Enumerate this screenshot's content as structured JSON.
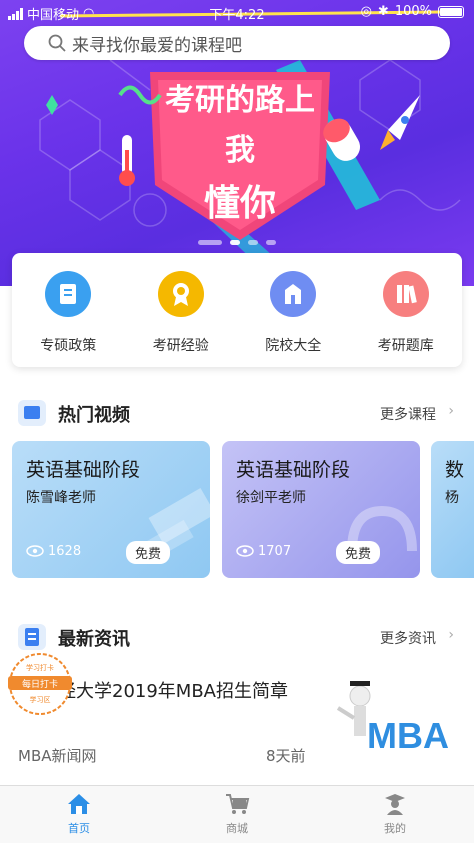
{
  "status_bar": {
    "carrier": "中国移动",
    "time": "下午4:22",
    "battery": "100%"
  },
  "search": {
    "placeholder": "来寻找你最爱的课程吧"
  },
  "banner": {
    "headline": "考研的路上",
    "line2": "我",
    "line3": "懂你",
    "slide_count": 4,
    "active_slide": 1
  },
  "quick_menu": [
    {
      "label": "专硕政策",
      "icon": "document-icon",
      "color": "#3aa0f0"
    },
    {
      "label": "考研经验",
      "icon": "award-ribbon-icon",
      "color": "#f5b800"
    },
    {
      "label": "院校大全",
      "icon": "school-building-icon",
      "color": "#6f8df2"
    },
    {
      "label": "考研题库",
      "icon": "books-icon",
      "color": "#f77f7f"
    }
  ],
  "hot_videos": {
    "title": "热门视频",
    "more": "更多课程",
    "cards": [
      {
        "title": "英语基础阶段",
        "teacher": "陈雪峰老师",
        "views": "1628",
        "badge": "免费"
      },
      {
        "title": "英语基础阶段",
        "teacher": "徐剑平老师",
        "views": "1707",
        "badge": "免费"
      },
      {
        "title": "数",
        "teacher": "杨",
        "views": "",
        "badge": ""
      }
    ]
  },
  "news": {
    "title": "最新资讯",
    "more": "更多资讯",
    "items": [
      {
        "title": "财经大学2019年MBA招生简章",
        "title_line2": "章",
        "source": "MBA新闻网",
        "time": "8天前",
        "image_text": "MBA"
      }
    ],
    "stamp": {
      "top": "学习打卡",
      "middle": "每日打卡",
      "bottom": "学习区"
    }
  },
  "tabbar": [
    {
      "label": "首页",
      "icon": "home-icon",
      "active": true
    },
    {
      "label": "商城",
      "icon": "cart-icon",
      "active": false
    },
    {
      "label": "我的",
      "icon": "graduate-icon",
      "active": false
    }
  ],
  "colors": {
    "banner_purple": "#6b33ea",
    "tab_active": "#2b8ee6",
    "card_blue": "#9fd0f5",
    "card_violet": "#a7a3f0"
  }
}
